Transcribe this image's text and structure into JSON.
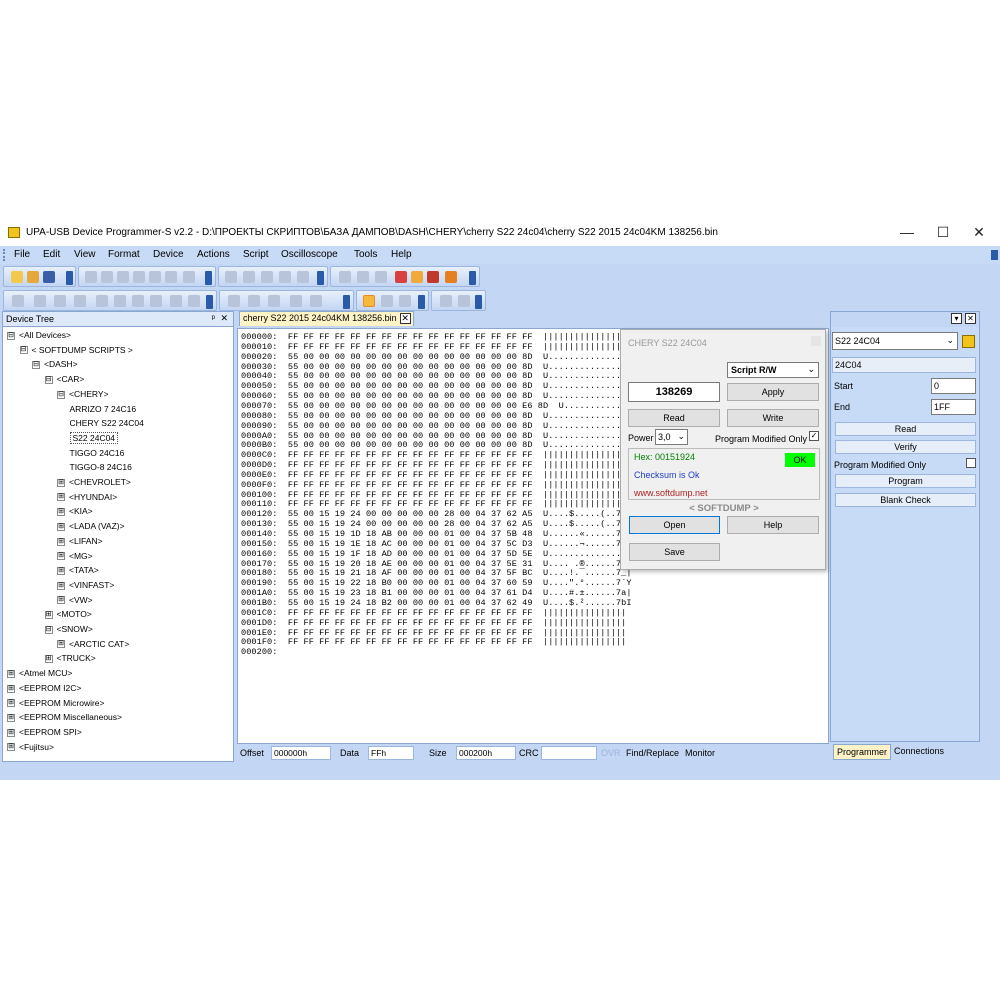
{
  "window": {
    "title": "UPA-USB Device Programmer-S v2.2 - D:\\ПРОЕКТЫ СКРИПТОВ\\БАЗА ДАМПОВ\\DASH\\CHERY\\cherry S22 24c04\\cherry S22 2015 24c04KM 138256.bin",
    "minimize": "—",
    "maximize": "☐",
    "close": "✕"
  },
  "menu": [
    "File",
    "Edit",
    "View",
    "Format",
    "Device",
    "Actions",
    "Script",
    "Oscilloscope",
    "Tools",
    "Help"
  ],
  "device_tree": {
    "title": "Device Tree",
    "pin": "ᵖ",
    "close": "✕",
    "items": [
      {
        "label": "<All Devices>",
        "exp": "⊟"
      },
      {
        "label": "< SOFTDUMP SCRIPTS >",
        "exp": "⊟"
      },
      {
        "label": "<DASH>",
        "exp": "⊟"
      },
      {
        "label": "<CAR>",
        "exp": "⊟"
      },
      {
        "label": "<CHERY>",
        "exp": "⊟"
      },
      {
        "label": "ARRIZO 7 24C16",
        "exp": ""
      },
      {
        "label": "CHERY S22 24C04",
        "exp": ""
      },
      {
        "label": "S22 24C04",
        "exp": ""
      },
      {
        "label": "TIGGO 24C16",
        "exp": ""
      },
      {
        "label": "TIGGO-8 24C16",
        "exp": ""
      },
      {
        "label": "<CHEVROLET>",
        "exp": "⊞"
      },
      {
        "label": "<HYUNDAI>",
        "exp": "⊞"
      },
      {
        "label": "<KIA>",
        "exp": "⊞"
      },
      {
        "label": "<LADA (VAZ)>",
        "exp": "⊞"
      },
      {
        "label": "<LIFAN>",
        "exp": "⊞"
      },
      {
        "label": "<MG>",
        "exp": "⊞"
      },
      {
        "label": "<TATA>",
        "exp": "⊞"
      },
      {
        "label": "<VINFAST>",
        "exp": "⊞"
      },
      {
        "label": "<VW>",
        "exp": "⊞"
      },
      {
        "label": "<MOTO>",
        "exp": "⊞"
      },
      {
        "label": "<SNOW>",
        "exp": "⊟"
      },
      {
        "label": "<ARCTIC CAT>",
        "exp": "⊞"
      },
      {
        "label": "<TRUCK>",
        "exp": "⊞"
      },
      {
        "label": "<Atmel MCU>",
        "exp": "⊞"
      },
      {
        "label": "<EEPROM I2C>",
        "exp": "⊞"
      },
      {
        "label": "<EEPROM Microwire>",
        "exp": "⊞"
      },
      {
        "label": "<EEPROM Miscellaneous>",
        "exp": "⊞"
      },
      {
        "label": "<EEPROM SPI>",
        "exp": "⊞"
      },
      {
        "label": "<Fujitsu>",
        "exp": "⊞"
      }
    ]
  },
  "doc_tab": {
    "label": "cherry S22 2015 24c04KM 138256.bin",
    "close": "✕"
  },
  "hex_lines": [
    "000000:  FF FF FF FF FF FF FF FF FF FF FF FF FF FF FF FF  ||||||||||||||||",
    "000010:  FF FF FF FF FF FF FF FF FF FF FF FF FF FF FF FF  ||||||||||||||||",
    "000020:  55 00 00 00 00 00 00 00 00 00 00 00 00 00 00 8D  U...............",
    "000030:  55 00 00 00 00 00 00 00 00 00 00 00 00 00 00 8D  U...............",
    "000040:  55 00 00 00 00 00 00 00 00 00 00 00 00 00 00 8D  U...............",
    "000050:  55 00 00 00 00 00 00 00 00 00 00 00 00 00 00 8D  U...............",
    "000060:  55 00 00 00 00 00 00 00 00 00 00 00 00 00 00 8D  U...............",
    "000070:  55 00 00 00 00 00 00 00 00 00 00 00 00 00 00 E6 8D  U..............",
    "000080:  55 00 00 00 00 00 00 00 00 00 00 00 00 00 00 8D  U...............",
    "000090:  55 00 00 00 00 00 00 00 00 00 00 00 00 00 00 8D  U...............",
    "0000A0:  55 00 00 00 00 00 00 00 00 00 00 00 00 00 00 8D  U...............",
    "0000B0:  55 00 00 00 00 00 00 00 00 00 00 00 00 00 00 8D  U...............",
    "0000C0:  FF FF FF FF FF FF FF FF FF FF FF FF FF FF FF FF  ||||||||||||||||",
    "0000D0:  FF FF FF FF FF FF FF FF FF FF FF FF FF FF FF FF  ||||||||||||||||",
    "0000E0:  FF FF FF FF FF FF FF FF FF FF FF FF FF FF FF FF  ||||||||||||||||",
    "0000F0:  FF FF FF FF FF FF FF FF FF FF FF FF FF FF FF FF  ||||||||||||||||",
    "000100:  FF FF FF FF FF FF FF FF FF FF FF FF FF FF FF FF  ||||||||||||||||",
    "000110:  FF FF FF FF FF FF FF FF FF FF FF FF FF FF FF FF  ||||||||||||||||",
    "000120:  55 00 15 19 24 00 00 00 00 00 28 00 04 37 62 A5  U....$.....(..7b",
    "000130:  55 00 15 19 24 00 00 00 00 00 28 00 04 37 62 A5  U....$.....(..7b",
    "000140:  55 00 15 19 1D 18 AB 00 00 00 01 00 04 37 5B 48  U......«......7[H",
    "000150:  55 00 15 19 1E 18 AC 00 00 00 01 00 04 37 5C D3  U......¬......7\\Ó",
    "000160:  55 00 15 19 1F 18 AD 00 00 00 01 00 04 37 5D 5E  U..............7]^",
    "000170:  55 00 15 19 20 18 AE 00 00 00 01 00 04 37 5E 31  U.... .®......7^1",
    "000180:  55 00 15 19 21 18 AF 00 00 00 01 00 04 37 5F BC  U....!.¯......7_|",
    "000190:  55 00 15 19 22 18 B0 00 00 00 01 00 04 37 60 59  U....\".°......7`Y",
    "0001A0:  55 00 15 19 23 18 B1 00 00 00 01 00 04 37 61 D4  U....#.±......7a|",
    "0001B0:  55 00 15 19 24 18 B2 00 00 00 01 00 04 37 62 49  U....$.²......7bI",
    "0001C0:  FF FF FF FF FF FF FF FF FF FF FF FF FF FF FF FF  ||||||||||||||||",
    "0001D0:  FF FF FF FF FF FF FF FF FF FF FF FF FF FF FF FF  ||||||||||||||||",
    "0001E0:  FF FF FF FF FF FF FF FF FF FF FF FF FF FF FF FF  ||||||||||||||||",
    "0001F0:  FF FF FF FF FF FF FF FF FF FF FF FF FF FF FF FF  ||||||||||||||||",
    "000200:"
  ],
  "statusbar": {
    "offset_label": "Offset",
    "offset_value": "000000h",
    "data_label": "Data",
    "data_value": "FFh",
    "size_label": "Size",
    "size_value": "000200h",
    "crc_label": "CRC",
    "crc_value": "",
    "ovr": "OVR",
    "find_replace": "Find/Replace",
    "monitor": "Monitor"
  },
  "script_dialog": {
    "title": "CHERY S22 24C04",
    "value": "138269",
    "script_select": "Script R/W",
    "apply": "Apply",
    "read": "Read",
    "write": "Write",
    "power_label": "Power",
    "power_value": "3,0",
    "program_modified_only": "Program Modified Only",
    "hex_text": "Hex: 00151924",
    "ok_badge": "OK",
    "checksum": "Checksum is Ok",
    "site": "www.softdump.net",
    "brand": "< SOFTDUMP >",
    "open": "Open",
    "help": "Help",
    "save": "Save"
  },
  "programmer_panel": {
    "device_select": "S22 24C04",
    "device_name": "24C04",
    "start_label": "Start",
    "start_value": "0",
    "end_label": "End",
    "end_value": "1FF",
    "read": "Read",
    "verify": "Verify",
    "program_modified_only": "Program Modified Only",
    "program": "Program",
    "blank_check": "Blank Check",
    "tab_programmer": "Programmer",
    "tab_connections": "Connections"
  },
  "colors": {
    "accent": "#c3d6f3",
    "tab_active": "#fef3c7",
    "ok_green": "#00ff00",
    "hex_green": "#008000",
    "checksum_blue": "#1e3cc8",
    "site_red": "#b22222"
  }
}
